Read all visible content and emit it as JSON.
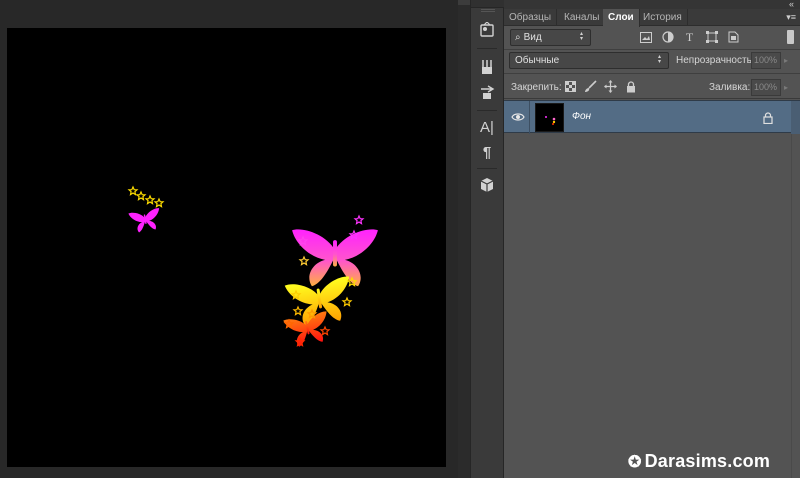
{
  "panel": {
    "tabs": [
      {
        "label": "Образцы",
        "active": false
      },
      {
        "label": "Каналы",
        "active": false
      },
      {
        "label": "Слои",
        "active": true
      },
      {
        "label": "История",
        "active": false
      }
    ],
    "filter": {
      "kind_label": "Вид",
      "icons": [
        "pixel-filter-icon",
        "adjustment-filter-icon",
        "type-filter-icon",
        "shape-filter-icon",
        "smart-object-filter-icon"
      ]
    },
    "blend_mode": "Обычные",
    "opacity_label": "Непрозрачность:",
    "opacity_value": "100%",
    "lock_label": "Закрепить:",
    "lock_icons": [
      "lock-transparent-icon",
      "lock-image-icon",
      "lock-position-icon",
      "lock-all-icon"
    ],
    "fill_label": "Заливка:",
    "fill_value": "100%",
    "layers": [
      {
        "name": "Фон",
        "visible": true,
        "locked": true,
        "selected": true
      }
    ]
  },
  "toolstrip": {
    "tools": [
      "3d-material-icon",
      "brush-preset-icon",
      "clone-source-icon",
      "character-icon",
      "paragraph-icon",
      "3d-cube-icon"
    ],
    "character_glyph": "A|",
    "paragraph_glyph": "¶"
  },
  "colors": {
    "canvas_bg": "#000000",
    "selected_layer": "#536c85",
    "panel_bg": "#535353",
    "workspace_bg": "#282828"
  },
  "watermark": {
    "text": "Darasims.com"
  }
}
